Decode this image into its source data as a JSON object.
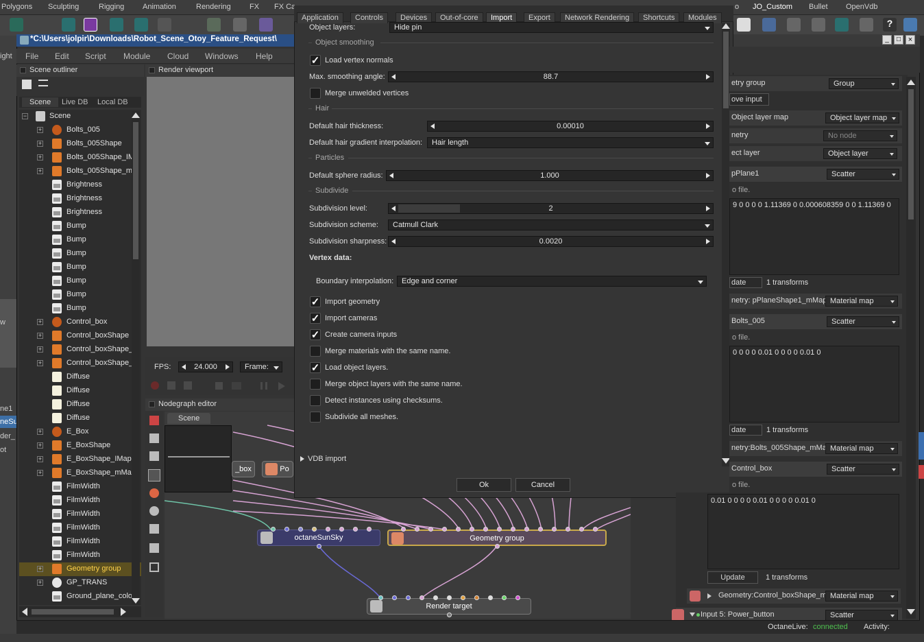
{
  "maya": {
    "tabs": [
      "Polygons",
      "Sculpting",
      "Rigging",
      "Animation",
      "Rendering",
      "FX",
      "FX Ca",
      "o",
      "JO_Custom",
      "Bullet",
      "OpenVdb"
    ],
    "left_edge_labels": [
      "ight",
      "w",
      "ne1",
      "neSu",
      "der_",
      "ot"
    ]
  },
  "window": {
    "title": "*C:\\Users\\jolpir\\Downloads\\Robot_Scene_Otoy_Feature_Request\\",
    "menu": [
      "File",
      "Edit",
      "Script",
      "Module",
      "Cloud",
      "Windows",
      "Help"
    ],
    "controls": [
      "_",
      "□",
      "×"
    ]
  },
  "outliner": {
    "header": "Scene outliner",
    "tabs": [
      "Scene",
      "Live DB",
      "Local DB"
    ],
    "root": "Scene",
    "items": [
      {
        "label": "Bolts_005",
        "icon": "geo",
        "expand": true
      },
      {
        "label": "Bolts_005Shape",
        "icon": "flame",
        "expand": true
      },
      {
        "label": "Bolts_005Shape_IM",
        "icon": "flame",
        "expand": true
      },
      {
        "label": "Bolts_005Shape_ml",
        "icon": "flame",
        "expand": true
      },
      {
        "label": "Brightness",
        "icon": "tex",
        "expand": false
      },
      {
        "label": "Brightness",
        "icon": "tex",
        "expand": false
      },
      {
        "label": "Brightness",
        "icon": "tex",
        "expand": false
      },
      {
        "label": "Bump",
        "icon": "tex",
        "expand": false
      },
      {
        "label": "Bump",
        "icon": "tex",
        "expand": false
      },
      {
        "label": "Bump",
        "icon": "tex",
        "expand": false
      },
      {
        "label": "Bump",
        "icon": "tex",
        "expand": false
      },
      {
        "label": "Bump",
        "icon": "tex",
        "expand": false
      },
      {
        "label": "Bump",
        "icon": "tex",
        "expand": false
      },
      {
        "label": "Bump",
        "icon": "tex",
        "expand": false
      },
      {
        "label": "Control_box",
        "icon": "geo",
        "expand": true
      },
      {
        "label": "Control_boxShape",
        "icon": "flame",
        "expand": true
      },
      {
        "label": "Control_boxShape_",
        "icon": "flame",
        "expand": true
      },
      {
        "label": "Control_boxShape_",
        "icon": "flame",
        "expand": true
      },
      {
        "label": "Diffuse",
        "icon": "diff",
        "expand": false
      },
      {
        "label": "Diffuse",
        "icon": "diff",
        "expand": false
      },
      {
        "label": "Diffuse",
        "icon": "diff",
        "expand": false
      },
      {
        "label": "Diffuse",
        "icon": "diff",
        "expand": false
      },
      {
        "label": "E_Box",
        "icon": "geo",
        "expand": true
      },
      {
        "label": "E_BoxShape",
        "icon": "flame",
        "expand": true
      },
      {
        "label": "E_BoxShape_IMap",
        "icon": "flame",
        "expand": true
      },
      {
        "label": "E_BoxShape_mMap",
        "icon": "flame",
        "expand": true
      },
      {
        "label": "FilmWidth",
        "icon": "tex",
        "expand": false
      },
      {
        "label": "FilmWidth",
        "icon": "tex",
        "expand": false
      },
      {
        "label": "FilmWidth",
        "icon": "tex",
        "expand": false
      },
      {
        "label": "FilmWidth",
        "icon": "tex",
        "expand": false
      },
      {
        "label": "FilmWidth",
        "icon": "tex",
        "expand": false
      },
      {
        "label": "FilmWidth",
        "icon": "tex",
        "expand": false
      },
      {
        "label": "Geometry group",
        "icon": "flame",
        "expand": true,
        "selected": true
      },
      {
        "label": "GP_TRANS",
        "icon": "sphere",
        "expand": true
      },
      {
        "label": "Ground_plane_colo",
        "icon": "tex",
        "expand": false
      }
    ]
  },
  "viewport": {
    "header": "Render viewport",
    "fps_label": "FPS:",
    "fps_value": "24.000",
    "frame_label": "Frame:"
  },
  "nodegraph": {
    "header": "Nodegraph editor",
    "tab": "Scene",
    "nodes": {
      "sunsky": "octaneSunSky",
      "geogroup": "Geometry group",
      "render": "Render target",
      "box": "_box",
      "po": "Po"
    }
  },
  "dialog": {
    "tabs": [
      "Application",
      "Controls",
      "Devices",
      "Out-of-core",
      "Import",
      "Export",
      "Network Rendering",
      "Shortcuts",
      "Modules"
    ],
    "active_tab": "Import",
    "object_layers_label": "Object layers:",
    "object_layers_value": "Hide pin",
    "sec_smoothing": "Object smoothing",
    "load_vertex_normals": {
      "label": "Load vertex normals",
      "checked": true
    },
    "max_smoothing_label": "Max. smoothing angle:",
    "max_smoothing_value": "88.7",
    "merge_unwelded": {
      "label": "Merge unwelded vertices",
      "checked": false
    },
    "sec_hair": "Hair",
    "hair_thickness_label": "Default hair thickness:",
    "hair_thickness_value": "0.00010",
    "hair_gradient_label": "Default hair gradient interpolation:",
    "hair_gradient_value": "Hair length",
    "sec_particles": "Particles",
    "sphere_radius_label": "Default sphere radius:",
    "sphere_radius_value": "1.000",
    "sec_subdivide": "Subdivide",
    "subdiv_level_label": "Subdivision level:",
    "subdiv_level_value": "2",
    "subdiv_level_fill": 0.2,
    "subdiv_scheme_label": "Subdivision scheme:",
    "subdiv_scheme_value": "Catmull Clark",
    "subdiv_sharpness_label": "Subdivision sharpness:",
    "subdiv_sharpness_value": "0.0020",
    "vertex_data_label": "Vertex data:",
    "boundary_label": "Boundary interpolation:",
    "boundary_value": "Edge and corner",
    "checks": [
      {
        "label": "Import geometry",
        "checked": true
      },
      {
        "label": "Import cameras",
        "checked": true
      },
      {
        "label": "Create camera inputs",
        "checked": true
      },
      {
        "label": "Merge materials with the same name.",
        "checked": false
      },
      {
        "label": "Load object layers.",
        "checked": true
      },
      {
        "label": "Merge object layers with the same name.",
        "checked": false
      },
      {
        "label": "Detect instances using checksums.",
        "checked": false
      },
      {
        "label": "Subdivide all meshes.",
        "checked": false
      }
    ],
    "vdb_import": "VDB import",
    "ok": "Ok",
    "cancel": "Cancel"
  },
  "inspector": {
    "geometry_group_label": "etry group",
    "geometry_group_value": "Group",
    "move_input": "ove input",
    "object_layer_map_label": "Object layer map",
    "object_layer_map_value": "Object layer map",
    "geometry_label": "netry",
    "geometry_value": "No node",
    "object_layer_label": "ect layer",
    "object_layer_value": "Object layer",
    "p1_name": "pPlane1",
    "p1_type": "Scatter",
    "p1_file": "o file.",
    "p1_data": "9 0 0 0 0 1.11369 0 0.000608359 0 0 1.11369 0",
    "p1_update": "date",
    "p1_transforms": "1 transforms",
    "p1_geom": "netry: pPlaneShape1_mMap",
    "p1_geom_value": "Material map",
    "p2_name": "Bolts_005",
    "p2_type": "Scatter",
    "p2_file": "o file.",
    "p2_data": "0 0 0 0 0.01 0 0 0 0 0.01 0",
    "p2_update": "date",
    "p2_transforms": "1 transforms",
    "p2_geom": "netry:Bolts_005Shape_mMap",
    "p2_geom_value": "Material map",
    "p3_name": "Control_box",
    "p3_type": "Scatter",
    "p3_file": "o file.",
    "p3_data": "0.01 0 0 0 0 0.01 0 0 0 0 0.01 0",
    "p3_update": "Update",
    "p3_transforms": "1 transforms",
    "p3_geom": "Geometry:Control_boxShape_mMap",
    "p3_geom_value": "Material map",
    "input5": "Input 5: Power_button",
    "input5_value": "Scatter"
  },
  "status": {
    "live_label": "OctaneLive:",
    "live_value": "connected",
    "activity_label": "Activity:"
  },
  "colors": {
    "accent_blue": "#2a4f85",
    "selection": "#5c5020",
    "selected_text": "#ffd24a",
    "connected": "#4fc04f"
  }
}
